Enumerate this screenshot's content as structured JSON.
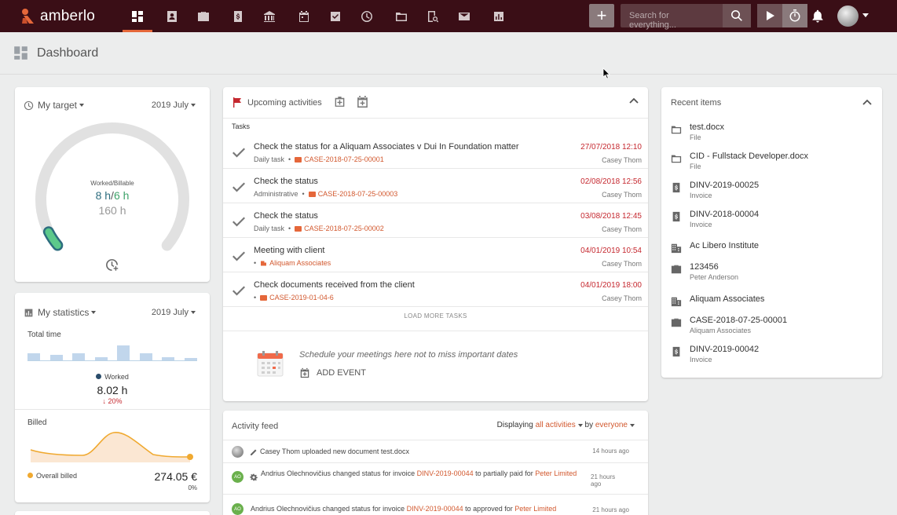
{
  "app": {
    "brand": "amberlo",
    "accent": "#e5673a",
    "nav_bg": "#3a0e16"
  },
  "nav": {
    "icons": [
      "dashboard-icon",
      "contacts-icon",
      "cases-icon",
      "invoices-icon",
      "institution-icon",
      "calendar-icon",
      "tasks-icon",
      "time-icon",
      "files-icon",
      "reports-search-icon",
      "mail-icon",
      "statistics-icon"
    ],
    "add_label": "+",
    "search_placeholder": "Search for everything..."
  },
  "page": {
    "title": "Dashboard"
  },
  "target": {
    "title": "My target",
    "period": "2019 July",
    "gauge_label": "Worked/Billable",
    "worked": "8 h",
    "separator": "/",
    "billable": "6 h",
    "goal": "160 h",
    "progress": 0.05
  },
  "stats": {
    "title": "My statistics",
    "period": "2019 July",
    "total_time_label": "Total time",
    "worked_legend": "Worked",
    "worked_value": "8.02 h",
    "worked_change": "20%",
    "billed_label": "Billed",
    "overall_billed_legend": "Overall billed",
    "overall_billed_value": "274.05 €",
    "overall_billed_change": "0%",
    "bars": [
      0.45,
      0.35,
      0.45,
      0.2,
      1.0,
      0.45,
      0.2,
      0.15
    ]
  },
  "upcoming": {
    "title": "Upcoming activities",
    "section": "Tasks",
    "tasks": [
      {
        "title": "Check the status for a Aliquam Associates v Dui In Foundation matter",
        "type": "Daily task",
        "ref": "CASE-2018-07-25-00001",
        "date": "27/07/2018 12:10",
        "user": "Casey Thom"
      },
      {
        "title": "Check the status",
        "type": "Administrative",
        "ref": "CASE-2018-07-25-00003",
        "date": "02/08/2018 12:56",
        "user": "Casey Thom"
      },
      {
        "title": "Check the status",
        "type": "Daily task",
        "ref": "CASE-2018-07-25-00002",
        "date": "03/08/2018 12:45",
        "user": "Casey Thom"
      },
      {
        "title": "Meeting with client",
        "type": "",
        "ref": "Aliquam Associates",
        "date": "04/01/2019 10:54",
        "user": "Casey Thom"
      },
      {
        "title": "Check documents received from the client",
        "type": "",
        "ref": "CASE-2019-01-04-6",
        "date": "04/01/2019 18:00",
        "user": "Casey Thom"
      }
    ],
    "load_more": "LOAD MORE TASKS",
    "schedule_text": "Schedule your meetings here not to miss important dates",
    "add_event": "ADD EVENT"
  },
  "feed": {
    "title": "Activity feed",
    "displaying": "Displaying",
    "filter_scope": "all activities",
    "by": "by",
    "filter_user": "everyone",
    "items": [
      {
        "text": "Casey Thom uploaded new document test.docx",
        "time": "14 hours ago"
      },
      {
        "avatar": "AO",
        "pre": "Andrius Olechnovičius changed status for invoice ",
        "link": "DINV-2019-00044",
        "mid": " to partially paid for ",
        "link2": "Peter Limited",
        "time": "21 hours ago"
      },
      {
        "avatar": "AO",
        "pre": "Andrius Olechnovičius changed status for invoice ",
        "link": "DINV-2019-00044",
        "mid": " to approved for ",
        "link2": "Peter Limited",
        "time": "21 hours ago"
      }
    ]
  },
  "recent": {
    "title": "Recent items",
    "items": [
      {
        "icon": "folder-icon",
        "name": "test.docx",
        "type": "File"
      },
      {
        "icon": "folder-icon",
        "name": "CID - Fullstack Developer.docx",
        "type": "File"
      },
      {
        "icon": "invoice-icon",
        "name": "DINV-2019-00025",
        "type": "Invoice"
      },
      {
        "icon": "invoice-icon",
        "name": "DINV-2018-00004",
        "type": "Invoice"
      },
      {
        "icon": "building-icon",
        "name": "Ac Libero Institute",
        "type": ""
      },
      {
        "icon": "briefcase-icon",
        "name": "123456",
        "type": "Peter Anderson"
      },
      {
        "icon": "building-icon",
        "name": "Aliquam Associates",
        "type": ""
      },
      {
        "icon": "briefcase-icon",
        "name": "CASE-2018-07-25-00001",
        "type": "Aliquam Associates"
      },
      {
        "icon": "invoice-icon",
        "name": "DINV-2019-00042",
        "type": "Invoice"
      }
    ]
  }
}
